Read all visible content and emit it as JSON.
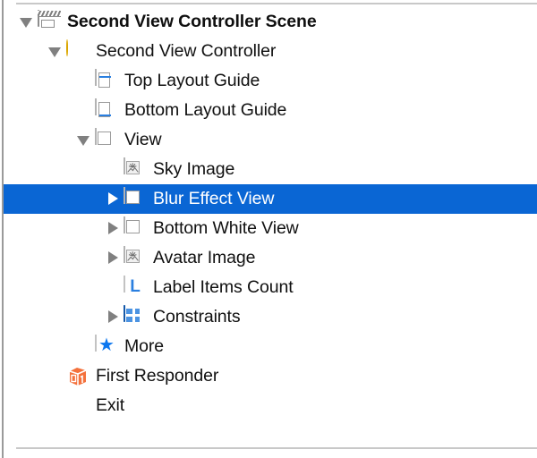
{
  "panel": {
    "name": "document-outline",
    "background": "#ffffff",
    "selection_color": "#0a66d4",
    "selection_text_color": "#ffffff",
    "text_color": "#101010"
  },
  "tree": {
    "rows": [
      {
        "label": "Second View Controller Scene",
        "icon": "scene-clapperboard-icon",
        "twisty": "open",
        "indent": 0,
        "bold": true,
        "selected": false
      },
      {
        "label": "Second View Controller",
        "icon": "view-controller-icon",
        "twisty": "open",
        "indent": 1,
        "bold": false,
        "selected": false
      },
      {
        "label": "Top Layout Guide",
        "icon": "top-layout-guide-icon",
        "twisty": "none",
        "indent": 2,
        "bold": false,
        "selected": false
      },
      {
        "label": "Bottom Layout Guide",
        "icon": "bottom-layout-guide-icon",
        "twisty": "none",
        "indent": 2,
        "bold": false,
        "selected": false
      },
      {
        "label": "View",
        "icon": "view-icon",
        "twisty": "open",
        "indent": 2,
        "bold": false,
        "selected": false
      },
      {
        "label": "Sky Image",
        "icon": "image-view-icon",
        "twisty": "none",
        "indent": 3,
        "bold": false,
        "selected": false
      },
      {
        "label": "Blur Effect View",
        "icon": "view-icon",
        "twisty": "closed",
        "indent": 3,
        "bold": false,
        "selected": true
      },
      {
        "label": "Bottom White View",
        "icon": "view-icon",
        "twisty": "closed",
        "indent": 3,
        "bold": false,
        "selected": false
      },
      {
        "label": "Avatar Image",
        "icon": "image-view-icon",
        "twisty": "closed",
        "indent": 3,
        "bold": false,
        "selected": false
      },
      {
        "label": "Label Items Count",
        "icon": "label-icon",
        "twisty": "none",
        "indent": 3,
        "bold": false,
        "selected": false
      },
      {
        "label": "Constraints",
        "icon": "constraints-icon",
        "twisty": "closed",
        "indent": 3,
        "bold": false,
        "selected": false
      },
      {
        "label": "More",
        "icon": "more-star-icon",
        "twisty": "none",
        "indent": 2,
        "bold": false,
        "selected": false
      },
      {
        "label": "First Responder",
        "icon": "first-responder-cube-icon",
        "twisty": "none",
        "indent": 1,
        "bold": false,
        "selected": false
      },
      {
        "label": "Exit",
        "icon": "exit-icon",
        "twisty": "none",
        "indent": 1,
        "bold": false,
        "selected": false
      }
    ]
  }
}
